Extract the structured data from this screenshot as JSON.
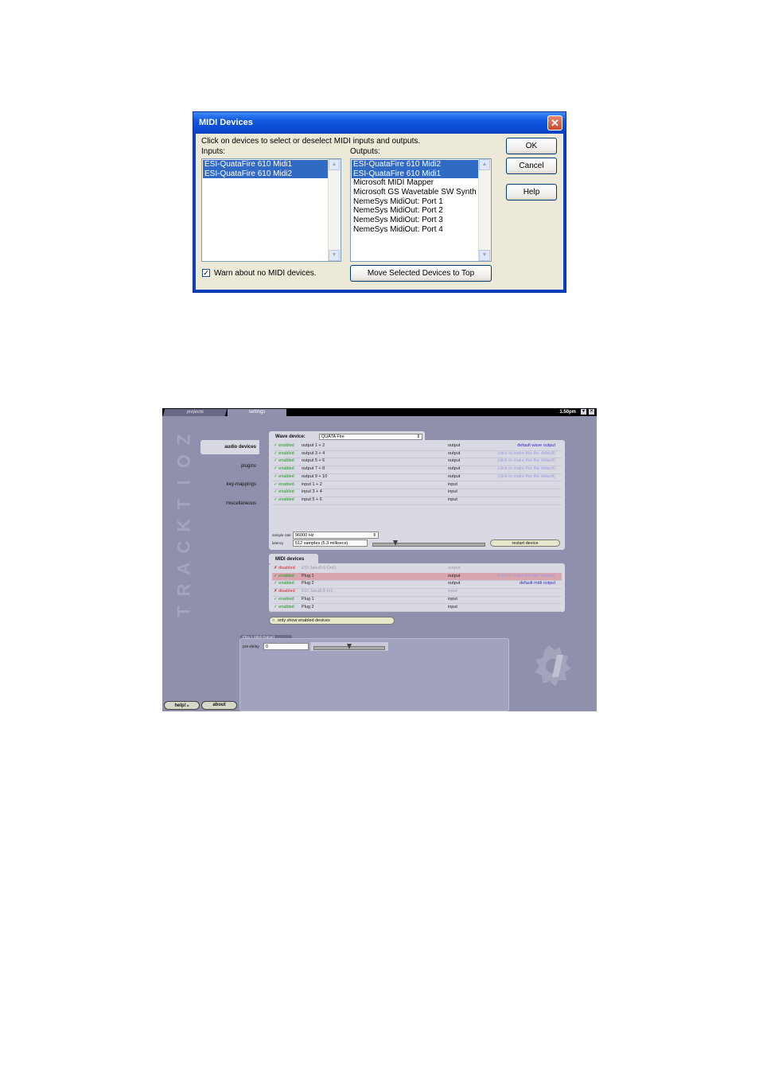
{
  "midi_dialog": {
    "title": "MIDI Devices",
    "close_glyph": "✕",
    "instructions": "Click on devices to select or deselect MIDI inputs and outputs.",
    "inputs_label": "Inputs:",
    "outputs_label": "Outputs:",
    "inputs": [
      {
        "label": "ESI-QuataFire 610 Midi1",
        "selected": true
      },
      {
        "label": "ESI-QuataFire 610 Midi2",
        "selected": true
      }
    ],
    "outputs": [
      {
        "label": "ESI-QuataFire 610 Midi2",
        "selected": true
      },
      {
        "label": "ESI-QuataFire 610 Midi1",
        "selected": true
      },
      {
        "label": "Microsoft MIDI Mapper",
        "selected": false
      },
      {
        "label": "Microsoft GS Wavetable SW Synth",
        "selected": false
      },
      {
        "label": "NemeSys MidiOut: Port 1",
        "selected": false
      },
      {
        "label": "NemeSys MidiOut: Port 2",
        "selected": false
      },
      {
        "label": "NemeSys MidiOut: Port 3",
        "selected": false
      },
      {
        "label": "NemeSys MidiOut: Port 4",
        "selected": false
      }
    ],
    "warn_checked": true,
    "warn_label": "Warn about no MIDI devices.",
    "move_top_label": "Move Selected Devices to Top",
    "ok_label": "OK",
    "cancel_label": "Cancel",
    "help_label": "Help",
    "colors": {
      "title_bar": "#0a3fbf",
      "selection": "#316ac5",
      "dialog_bg": "#ece9d8"
    }
  },
  "tracktion": {
    "tabs": {
      "projects": "projects",
      "settings": "settings"
    },
    "time": "1.50pm",
    "window_icons": [
      "minimize-icon",
      "close-icon"
    ],
    "brand_letters": [
      "Z",
      "O",
      "I",
      "T",
      "K",
      "C",
      "A",
      "R",
      "T"
    ],
    "nav": {
      "audio_devices": "audio devices",
      "plugins": "plugins",
      "key_mappings": "key-mappings",
      "miscellaneous": "miscellaneous"
    },
    "wave": {
      "label": "Wave device:",
      "device": "QUATA Fire",
      "rows": [
        {
          "status": "✓ enabled",
          "ok": true,
          "name": "output 1 + 2",
          "io": "output",
          "default": "default wave output",
          "default_style": "link"
        },
        {
          "status": "✓ enabled",
          "ok": true,
          "name": "output 3 + 4",
          "io": "output",
          "default": "(click to make this the default)",
          "default_style": "dim"
        },
        {
          "status": "✓ enabled",
          "ok": true,
          "name": "output 5 + 6",
          "io": "output",
          "default": "(click to make this the default)",
          "default_style": "dim"
        },
        {
          "status": "✓ enabled",
          "ok": true,
          "name": "output 7 + 8",
          "io": "output",
          "default": "(click to make this the default)",
          "default_style": "dim"
        },
        {
          "status": "✓ enabled",
          "ok": true,
          "name": "output 9 + 10",
          "io": "output",
          "default": "(click to make this the default)",
          "default_style": "dim"
        },
        {
          "status": "✓ enabled",
          "ok": true,
          "name": "input 1 + 2",
          "io": "input",
          "default": "",
          "default_style": "dim"
        },
        {
          "status": "✓ enabled",
          "ok": true,
          "name": "input 3 + 4",
          "io": "input",
          "default": "",
          "default_style": "dim"
        },
        {
          "status": "✓ enabled",
          "ok": true,
          "name": "input 5 + 6",
          "io": "input",
          "default": "",
          "default_style": "dim"
        }
      ],
      "sample_rate_label": "sample rate",
      "sample_rate": "96000 Hz",
      "latency_label": "latency",
      "latency": "512 samples  (5.3 millisecs)",
      "latency_slider_position": 0.2,
      "restart_label": "restart device"
    },
    "midi": {
      "label": "MIDI devices",
      "rows": [
        {
          "status": "✗ disabled",
          "ok": false,
          "name": "ESI Jaku8-5-Out1",
          "io": "output",
          "default": "",
          "default_style": "dim",
          "highlight": false
        },
        {
          "status": "✓ enabled",
          "ok": true,
          "name": "Plug 1",
          "io": "output",
          "default": "(click to make this the default)",
          "default_style": "dim",
          "highlight": true
        },
        {
          "status": "✓ enabled",
          "ok": true,
          "name": "Plug 2",
          "io": "output",
          "default": "default midi output",
          "default_style": "link",
          "highlight": false
        },
        {
          "status": "✗ disabled",
          "ok": false,
          "name": "ESI Jaku8-5-In1",
          "io": "input",
          "default": "",
          "default_style": "dim",
          "highlight": false
        },
        {
          "status": "✓ enabled",
          "ok": true,
          "name": "Plug 1",
          "io": "input",
          "default": "",
          "default_style": "dim",
          "highlight": false
        },
        {
          "status": "✓ enabled",
          "ok": true,
          "name": "Plug 2",
          "io": "input",
          "default": "",
          "default_style": "dim",
          "highlight": false
        }
      ],
      "filter_label": "only show enabled devices"
    },
    "plugin_panel": {
      "tab_label": "Plug 1 (Midi Output)",
      "predelay_label": "pre-delay",
      "predelay_value": "0",
      "predelay_slider_position": 0.5
    },
    "help_label": "help!",
    "about_label": "about",
    "colors": {
      "background": "#8f90ac",
      "panel": "#d9d9e4",
      "enabled": "#1a9a1a",
      "disabled": "#cc2a2a",
      "link": "#2b2bd0",
      "highlight": "#d9a6b0"
    }
  }
}
